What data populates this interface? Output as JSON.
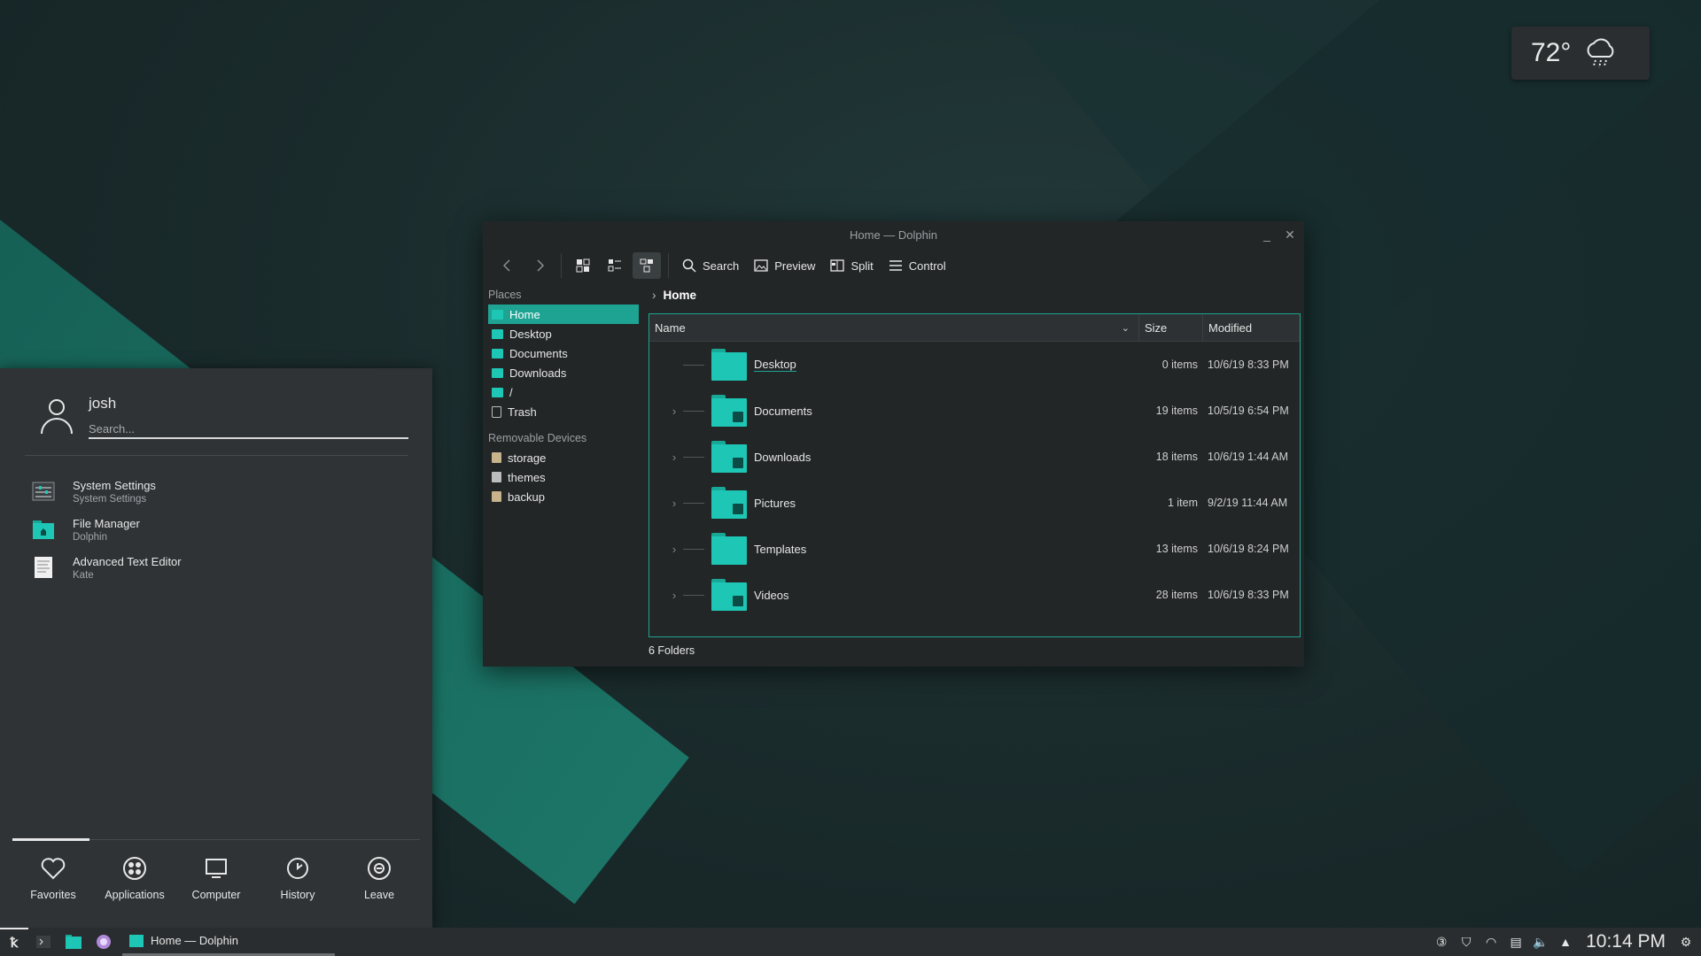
{
  "weather": {
    "temperature": "72°",
    "icon": "rain-cloud-icon"
  },
  "dolphin": {
    "title": "Home — Dolphin",
    "toolbar": {
      "search": "Search",
      "preview": "Preview",
      "split": "Split",
      "control": "Control"
    },
    "places_header": "Places",
    "places": [
      "Home",
      "Desktop",
      "Documents",
      "Downloads",
      "/",
      "Trash"
    ],
    "removable_header": "Removable Devices",
    "devices": [
      "storage",
      "themes",
      "backup"
    ],
    "breadcrumb": "Home",
    "columns": {
      "name": "Name",
      "size": "Size",
      "modified": "Modified"
    },
    "rows": [
      {
        "name": "Desktop",
        "size": "0 items",
        "modified": "10/6/19 8:33 PM"
      },
      {
        "name": "Documents",
        "size": "19 items",
        "modified": "10/5/19 6:54 PM"
      },
      {
        "name": "Downloads",
        "size": "18 items",
        "modified": "10/6/19 1:44 AM"
      },
      {
        "name": "Pictures",
        "size": "1 item",
        "modified": "9/2/19 11:44 AM"
      },
      {
        "name": "Templates",
        "size": "13 items",
        "modified": "10/6/19 8:24 PM"
      },
      {
        "name": "Videos",
        "size": "28 items",
        "modified": "10/6/19 8:33 PM"
      }
    ],
    "status": "6 Folders"
  },
  "launcher": {
    "user": "josh",
    "search_placeholder": "Search...",
    "apps": [
      {
        "title": "System Settings",
        "subtitle": "System Settings"
      },
      {
        "title": "File Manager",
        "subtitle": "Dolphin"
      },
      {
        "title": "Advanced Text Editor",
        "subtitle": "Kate"
      }
    ],
    "tabs": [
      "Favorites",
      "Applications",
      "Computer",
      "History",
      "Leave"
    ]
  },
  "taskbar": {
    "task_title": "Home — Dolphin",
    "clock": "10:14 PM"
  },
  "colors": {
    "accent": "#1ec7b5",
    "selection": "#1ea393",
    "window_bg": "#232627",
    "panel_bg": "#2f3336"
  }
}
